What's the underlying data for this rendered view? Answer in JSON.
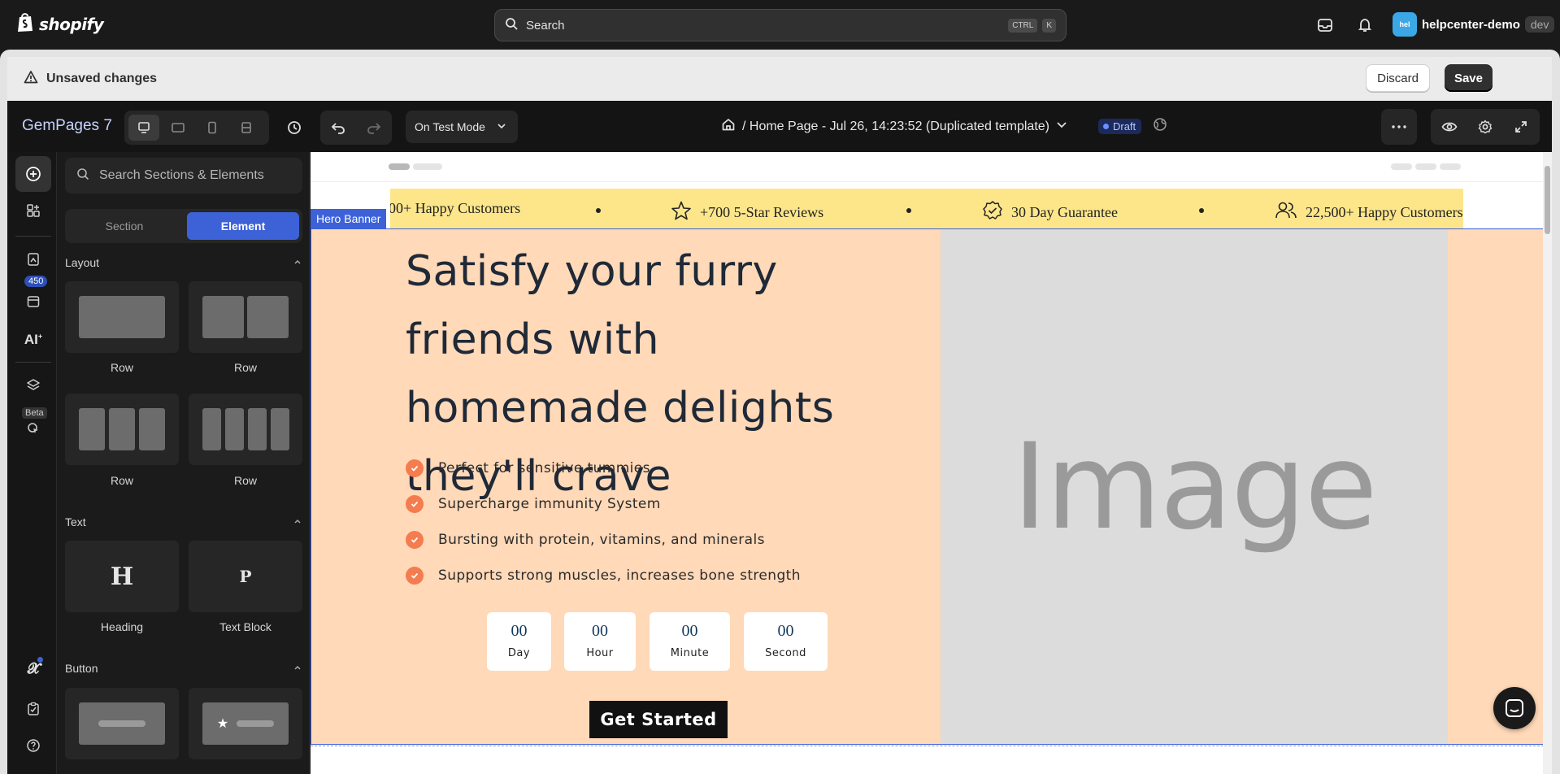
{
  "shopify": {
    "logo_text": "shopify",
    "search_placeholder": "Search",
    "shortcut": [
      "CTRL",
      "K"
    ],
    "store_avatar": "hel",
    "store_name": "helpcenter-demo",
    "store_tag": "dev"
  },
  "save_bar": {
    "message": "Unsaved changes",
    "discard_label": "Discard",
    "save_label": "Save"
  },
  "editor": {
    "brand": "GemPages 7",
    "mode_label": "On Test Mode",
    "page_title": "/ Home Page - Jul 26, 14:23:52 (Duplicated template)",
    "status": "Draft",
    "accent_color": "#3d62d8"
  },
  "rail": {
    "badge_count": "450",
    "beta_label": "Beta"
  },
  "panel": {
    "search_placeholder": "Search Sections & Elements",
    "tabs": [
      "Section",
      "Element"
    ],
    "active_tab": "Element",
    "sections": {
      "layout": {
        "title": "Layout",
        "items": [
          "Row",
          "Row",
          "Row",
          "Row"
        ]
      },
      "text": {
        "title": "Text",
        "items": [
          "Heading",
          "Text Block"
        ],
        "glyphs": [
          "H",
          "P"
        ]
      },
      "button": {
        "title": "Button"
      }
    }
  },
  "canvas": {
    "marquee": {
      "items": [
        "00+ Happy Customers",
        "+700 5-Star Reviews",
        "30 Day Guarantee",
        "22,500+ Happy Customers"
      ],
      "bg_color": "#fde68a"
    },
    "hero_tag": "Hero Banner",
    "hero": {
      "bg_color": "#ffd9b8",
      "headline": "Satisfy your furry friends with homemade delights they'll crave",
      "bullets": [
        "Perfect for sensitive tummies",
        "Supercharge immunity System",
        "Bursting with protein, vitamins, and minerals",
        "Supports strong muscles, increases bone strength"
      ],
      "countdown": [
        {
          "value": "00",
          "unit": "Day"
        },
        {
          "value": "00",
          "unit": "Hour"
        },
        {
          "value": "00",
          "unit": "Minute"
        },
        {
          "value": "00",
          "unit": "Second"
        }
      ],
      "cta_label": "Get Started",
      "image_placeholder": "Image",
      "bullet_color": "#f47c4f"
    }
  }
}
